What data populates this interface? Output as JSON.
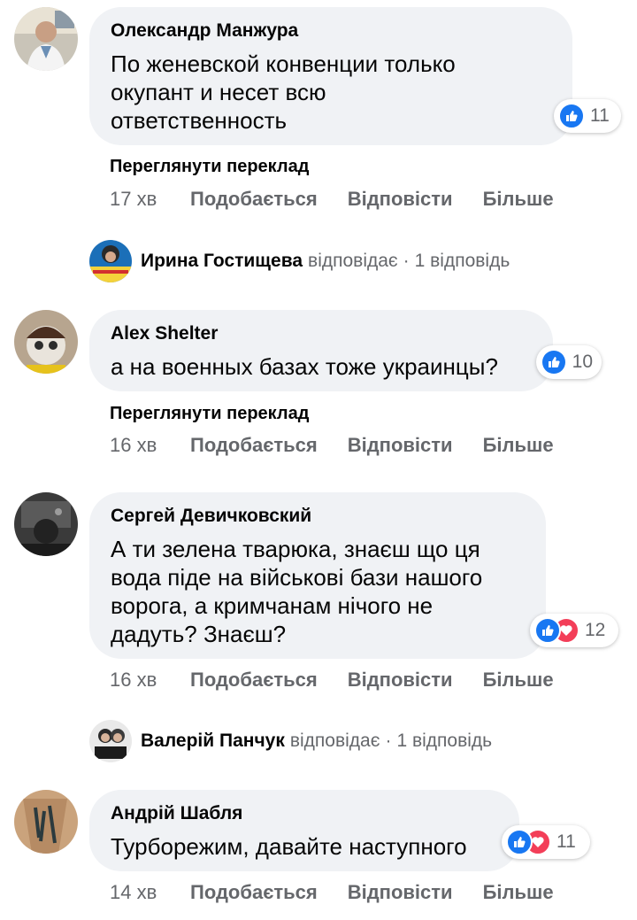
{
  "comments": [
    {
      "author": "Олександр Манжура",
      "text": "По женевской конвенции только\nокупант и несет всю\nответственность",
      "reactions": {
        "icons": [
          "like-icon"
        ],
        "count": "11"
      },
      "translate": "Переглянути переклад",
      "time": "17 хв"
    },
    {
      "author": "Alex Shelter",
      "text": "а на военных базах тоже украинцы?",
      "reactions": {
        "icons": [
          "like-icon"
        ],
        "count": "10"
      },
      "translate": "Переглянути переклад",
      "time": "16 хв"
    },
    {
      "author": "Сергей Девичковский",
      "text": "А ти зелена тварюка, знаєш що ця\nвода піде на військові бази нашого\nворога, а кримчанам нічого не\nдадуть? Знаєш?",
      "reactions": {
        "icons": [
          "like-icon",
          "love-icon"
        ],
        "count": "12"
      },
      "time": "16 хв"
    },
    {
      "author": "Андрій Шабля",
      "text": "Турборежим, давайте наступного",
      "reactions": {
        "icons": [
          "like-icon",
          "love-icon"
        ],
        "count": "11"
      },
      "time": "14 хв"
    }
  ],
  "replies": [
    {
      "name": "Ирина Гостищева",
      "verb": "відповідає",
      "dot": "·",
      "count": "1 відповідь"
    },
    {
      "name": "Валерій Панчук",
      "verb": "відповідає",
      "dot": "·",
      "count": "1 відповідь"
    }
  ],
  "actions": {
    "like": "Подобається",
    "reply": "Відповісти",
    "more": "Більше"
  },
  "colors": {
    "bubble": "#f0f2f5",
    "like": "#1877f2",
    "love": "#f33e58",
    "meta": "#65676b"
  }
}
